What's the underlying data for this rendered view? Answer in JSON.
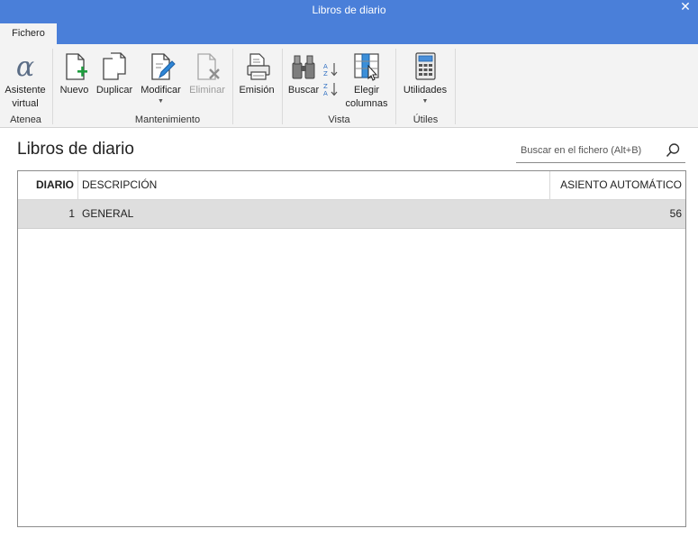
{
  "window": {
    "title": "Libros de diario"
  },
  "tabs": [
    {
      "label": "Fichero"
    }
  ],
  "ribbon": {
    "groups": {
      "atenea": "Atenea",
      "mantenimiento": "Mantenimiento",
      "vista": "Vista",
      "utiles": "Útiles"
    },
    "buttons": {
      "asistente_line1": "Asistente",
      "asistente_line2": "virtual",
      "nuevo": "Nuevo",
      "duplicar": "Duplicar",
      "modificar": "Modificar",
      "eliminar": "Eliminar",
      "emision": "Emisión",
      "buscar": "Buscar",
      "elegir_line1": "Elegir",
      "elegir_line2": "columnas",
      "utilidades": "Utilidades"
    },
    "icons": [
      "alpha-icon",
      "new-document-icon",
      "duplicate-icon",
      "edit-document-icon",
      "delete-document-icon",
      "printer-icon",
      "binoculars-icon",
      "sort-az-icon",
      "sort-za-icon",
      "columns-icon",
      "calculator-icon"
    ]
  },
  "page": {
    "title": "Libros de diario",
    "search_placeholder": "Buscar en el fichero (Alt+B)"
  },
  "table": {
    "columns": {
      "diario": "DIARIO",
      "descripcion": "DESCRIPCIÓN",
      "asiento": "ASIENTO AUTOMÁTICO"
    },
    "rows": [
      {
        "diario": "1",
        "descripcion": "GENERAL",
        "asiento": "56"
      }
    ]
  },
  "colors": {
    "accent": "#4a7fd9",
    "ribbon_bg": "#f3f3f3",
    "selected_row": "#dedede"
  }
}
